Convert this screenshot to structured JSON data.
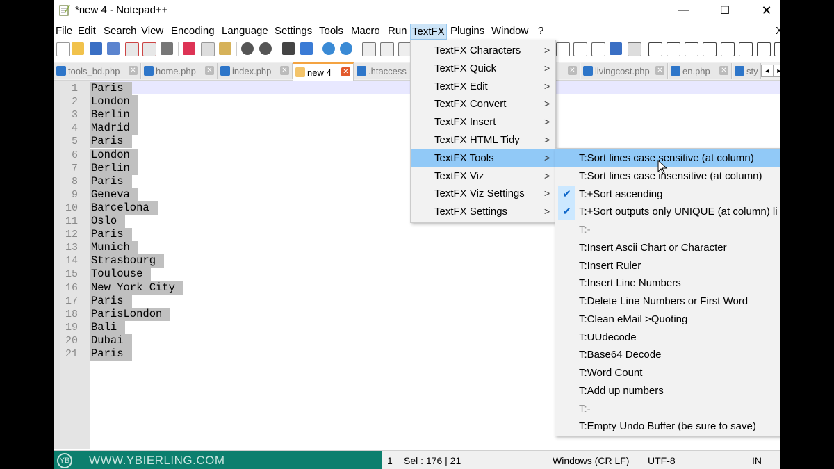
{
  "window": {
    "title": "*new 4 - Notepad++",
    "minimize_glyph": "—",
    "maximize_glyph": "☐",
    "close_glyph": "✕"
  },
  "menubar": [
    "File",
    "Edit",
    "Search",
    "View",
    "Encoding",
    "Language",
    "Settings",
    "Tools",
    "Macro",
    "Run",
    "TextFX",
    "Plugins",
    "Window",
    "?"
  ],
  "menubar_close": "X",
  "tabs": [
    {
      "label": "tools_bd.php",
      "active": false
    },
    {
      "label": "home.php",
      "active": false
    },
    {
      "label": "index.php",
      "active": false
    },
    {
      "label": "new 4",
      "active": true
    },
    {
      "label": ".htaccess",
      "active": false
    },
    {
      "label": "livingcost.php",
      "active": false
    },
    {
      "label": "en.php",
      "active": false
    },
    {
      "label": "sty",
      "active": false
    }
  ],
  "tab_close_glyph": "✕",
  "tab_scroll": [
    "◄",
    "►"
  ],
  "editor": {
    "lines": [
      "Paris",
      "London",
      "Berlin",
      "Madrid",
      "Paris",
      "London",
      "Berlin",
      "Paris",
      "Geneva",
      "Barcelona",
      "Oslo",
      "Paris",
      "Munich",
      "Strasbourg",
      "Toulouse",
      "New York City",
      "Paris",
      "ParisLondon",
      "Bali",
      "Dubai",
      "Paris"
    ]
  },
  "textfx_menu": [
    {
      "label": "TextFX Characters",
      "submenu": true
    },
    {
      "label": "TextFX Quick",
      "submenu": true
    },
    {
      "label": "TextFX Edit",
      "submenu": true
    },
    {
      "label": "TextFX Convert",
      "submenu": true
    },
    {
      "label": "TextFX Insert",
      "submenu": true
    },
    {
      "label": "TextFX HTML Tidy",
      "submenu": true
    },
    {
      "label": "TextFX Tools",
      "submenu": true,
      "highlighted": true
    },
    {
      "label": "TextFX Viz",
      "submenu": true
    },
    {
      "label": "TextFX Viz Settings",
      "submenu": true
    },
    {
      "label": "TextFX Settings",
      "submenu": true
    }
  ],
  "submenu_arrow": ">",
  "check_glyph": "✔",
  "tools_submenu": [
    {
      "label": "T:Sort lines case sensitive (at column)",
      "highlighted": true
    },
    {
      "label": "T:Sort lines case insensitive (at column)"
    },
    {
      "label": "T:+Sort ascending",
      "checked": true
    },
    {
      "label": "T:+Sort outputs only UNIQUE (at column) li",
      "checked": true
    },
    {
      "label": "T:-",
      "disabled": true
    },
    {
      "label": "T:Insert Ascii Chart or Character"
    },
    {
      "label": "T:Insert Ruler"
    },
    {
      "label": "T:Insert Line Numbers"
    },
    {
      "label": "T:Delete Line Numbers or First Word"
    },
    {
      "label": "T:Clean eMail >Quoting"
    },
    {
      "label": "T:UUdecode"
    },
    {
      "label": "T:Base64 Decode"
    },
    {
      "label": "T:Word Count"
    },
    {
      "label": "T:Add up numbers"
    },
    {
      "label": "T:-",
      "disabled": true
    },
    {
      "label": "T:Empty Undo Buffer (be sure to save)"
    }
  ],
  "statusbar": {
    "brand": "WWW.YBIERLING.COM",
    "brand_logo": "YB",
    "line": "1",
    "sel": "Sel : 176 | 21",
    "eol": "Windows (CR LF)",
    "encoding": "UTF-8",
    "mode": "IN"
  },
  "colors": {
    "accent": "#f4a341",
    "menu_highlight": "#91c9f7",
    "selection": "#c0c0c0",
    "brand": "#0c7f6e"
  }
}
